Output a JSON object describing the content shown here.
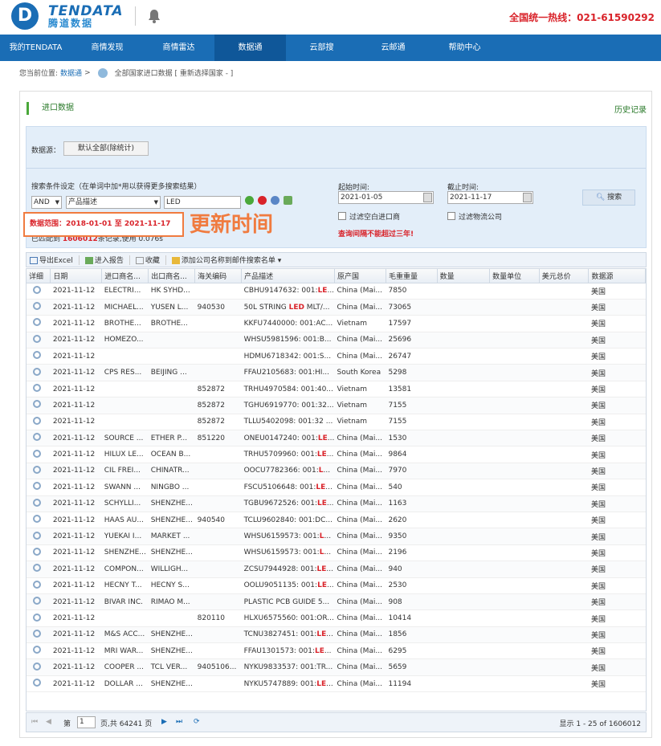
{
  "header": {
    "logo_letter": "D",
    "logo_en": "TENDATA",
    "logo_cn": "腾道数据",
    "hotline": "全国统一热线：021-61590292"
  },
  "nav": [
    {
      "label": "我的TENDATA"
    },
    {
      "label": "商情发现"
    },
    {
      "label": "商情雷达"
    },
    {
      "label": "数据通"
    },
    {
      "label": "云部搜"
    },
    {
      "label": "云邮通"
    },
    {
      "label": "帮助中心"
    }
  ],
  "breadcrumb": {
    "prefix": "您当前位置:",
    "link": "数据通",
    "arrow": ">",
    "current": "全部国家进口数据 [ 重新选择国家 - ]"
  },
  "panel": {
    "title": "进口数据",
    "history": "历史记录"
  },
  "filter": {
    "source_label": "数据源：",
    "source_button": "默认全部(除统计)",
    "search_hint": "搜索条件设定（在单词中加*用以获得更多搜索结果）",
    "logic": "AND",
    "field": "产品描述",
    "keyword": "LED",
    "start_label": "起始时间:",
    "start_date": "2021-01-05",
    "end_label": "截止时间:",
    "end_date": "2021-11-17",
    "search_button": "搜索",
    "check_empty_importer": "过滤空白进口商",
    "check_logistics": "过滤物流公司",
    "warning": "查询间隔不能超过三年!",
    "data_range": "数据范围：2018-01-01 至 2021-11-17",
    "match_prefix": "已匹配到",
    "match_count": "1606012",
    "match_suffix": "条记录,使用 0.076s",
    "annotation": "更新时间"
  },
  "toolbar": {
    "export": "导出Excel",
    "report": "进入报告",
    "collect": "收藏",
    "mail": "添加公司名称到邮件搜索名单"
  },
  "columns": [
    "详细",
    "日期",
    "进口商名...",
    "出口商名...",
    "海关编码",
    "产品描述",
    "原产国",
    "毛重重量",
    "数量",
    "数量单位",
    "美元总价",
    "数据源"
  ],
  "rows": [
    [
      "2021-11-12",
      "ELECTRI...",
      "HK SYHD...",
      "",
      "CBHU9147632: 001:",
      "LE",
      "...",
      "China (Mai...",
      "7850",
      "",
      "",
      "",
      "美国"
    ],
    [
      "2021-11-12",
      "MICHAEL...",
      "YUSEN L...",
      "940530",
      "50L STRING ",
      "LED",
      " MLT/...",
      "China (Mai...",
      "73065",
      "",
      "",
      "",
      "美国"
    ],
    [
      "2021-11-12",
      "BROTHE...",
      "BROTHE...",
      "",
      "KKFU7440000: 001:AC...",
      "",
      "",
      "Vietnam",
      "17597",
      "",
      "",
      "",
      "美国"
    ],
    [
      "2021-11-12",
      "HOMEZO...",
      "",
      "",
      "WHSU5981596: 001:B...",
      "",
      "",
      "China (Mai...",
      "25696",
      "",
      "",
      "",
      "美国"
    ],
    [
      "2021-11-12",
      "",
      "",
      "",
      "HDMU6718342: 001:S...",
      "",
      "",
      "China (Mai...",
      "26747",
      "",
      "",
      "",
      "美国"
    ],
    [
      "2021-11-12",
      "CPS RES...",
      "BEIJING ...",
      "",
      "FFAU2105683: 001:HI...",
      "",
      "",
      "South Korea",
      "5298",
      "",
      "",
      "",
      "美国"
    ],
    [
      "2021-11-12",
      "",
      "",
      "852872",
      "TRHU4970584: 001:40...",
      "",
      "",
      "Vietnam",
      "13581",
      "",
      "",
      "",
      "美国"
    ],
    [
      "2021-11-12",
      "",
      "",
      "852872",
      "TGHU6919770: 001:32...",
      "",
      "",
      "Vietnam",
      "7155",
      "",
      "",
      "",
      "美国"
    ],
    [
      "2021-11-12",
      "",
      "",
      "852872",
      "TLLU5402098: 001:32 ...",
      "",
      "",
      "Vietnam",
      "7155",
      "",
      "",
      "",
      "美国"
    ],
    [
      "2021-11-12",
      "SOURCE ...",
      "ETHER P...",
      "851220",
      "ONEU0147240: 001:",
      "LE",
      "...",
      "China (Mai...",
      "1530",
      "",
      "",
      "",
      "美国"
    ],
    [
      "2021-11-12",
      "HILUX LE...",
      "OCEAN B...",
      "",
      "TRHU5709960: 001:",
      "LE",
      "...",
      "China (Mai...",
      "9864",
      "",
      "",
      "",
      "美国"
    ],
    [
      "2021-11-12",
      "CIL FREI...",
      "CHINATR...",
      "",
      "OOCU7782366: 001:",
      "L",
      "...",
      "China (Mai...",
      "7970",
      "",
      "",
      "",
      "美国"
    ],
    [
      "2021-11-12",
      "SWANN ...",
      "NINGBO ...",
      "",
      "FSCU5106648: 001:",
      "LE",
      "...",
      "China (Mai...",
      "540",
      "",
      "",
      "",
      "美国"
    ],
    [
      "2021-11-12",
      "SCHYLLI...",
      "SHENZHE...",
      "",
      "TGBU9672526: 001:",
      "LE",
      "...",
      "China (Mai...",
      "1163",
      "",
      "",
      "",
      "美国"
    ],
    [
      "2021-11-12",
      "HAAS AU...",
      "SHENZHE...",
      "940540",
      "TCLU9602840: 001:DC...",
      "",
      "",
      "China (Mai...",
      "2620",
      "",
      "",
      "",
      "美国"
    ],
    [
      "2021-11-12",
      "YUEKAI I...",
      "MARKET ...",
      "",
      "WHSU6159573: 001:",
      "L",
      "...",
      "China (Mai...",
      "9350",
      "",
      "",
      "",
      "美国"
    ],
    [
      "2021-11-12",
      "SHENZHE...",
      "SHENZHE...",
      "",
      "WHSU6159573: 001:",
      "L",
      "...",
      "China (Mai...",
      "2196",
      "",
      "",
      "",
      "美国"
    ],
    [
      "2021-11-12",
      "COMPON...",
      "WILLIGH...",
      "",
      "ZCSU7944928: 001:",
      "LE",
      "...",
      "China (Mai...",
      "940",
      "",
      "",
      "",
      "美国"
    ],
    [
      "2021-11-12",
      "HECNY T...",
      "HECNY S...",
      "",
      "OOLU9051135: 001:",
      "LE",
      "...",
      "China (Mai...",
      "2530",
      "",
      "",
      "",
      "美国"
    ],
    [
      "2021-11-12",
      "BIVAR INC.",
      "RIMAO M...",
      "",
      "PLASTIC PCB GUIDE 5...",
      "",
      "",
      "China (Mai...",
      "908",
      "",
      "",
      "",
      "美国"
    ],
    [
      "2021-11-12",
      "",
      "",
      "820110",
      "HLXU6575560: 001:OR...",
      "",
      "",
      "China (Mai...",
      "10414",
      "",
      "",
      "",
      "美国"
    ],
    [
      "2021-11-12",
      "M&S ACC...",
      "SHENZHE...",
      "",
      "TCNU3827451: 001:",
      "LE",
      "...",
      "China (Mai...",
      "1856",
      "",
      "",
      "",
      "美国"
    ],
    [
      "2021-11-12",
      "MRI WAR...",
      "SHENZHE...",
      "",
      "FFAU1301573: 001:",
      "LE",
      "...",
      "China (Mai...",
      "6295",
      "",
      "",
      "",
      "美国"
    ],
    [
      "2021-11-12",
      "COOPER ...",
      "TCL VER...",
      "9405106...",
      "NYKU9833537: 001:TR...",
      "",
      "",
      "China (Mai...",
      "5659",
      "",
      "",
      "",
      "美国"
    ],
    [
      "2021-11-12",
      "DOLLAR ...",
      "SHENZHE...",
      "",
      "NYKU5747889: 001:",
      "LE",
      "...",
      "China (Mai...",
      "11194",
      "",
      "",
      "",
      "美国"
    ]
  ],
  "pager": {
    "page_label": "第",
    "page_value": "1",
    "total": "页,共 64241 页",
    "display": "显示 1 - 25 of 1606012"
  }
}
